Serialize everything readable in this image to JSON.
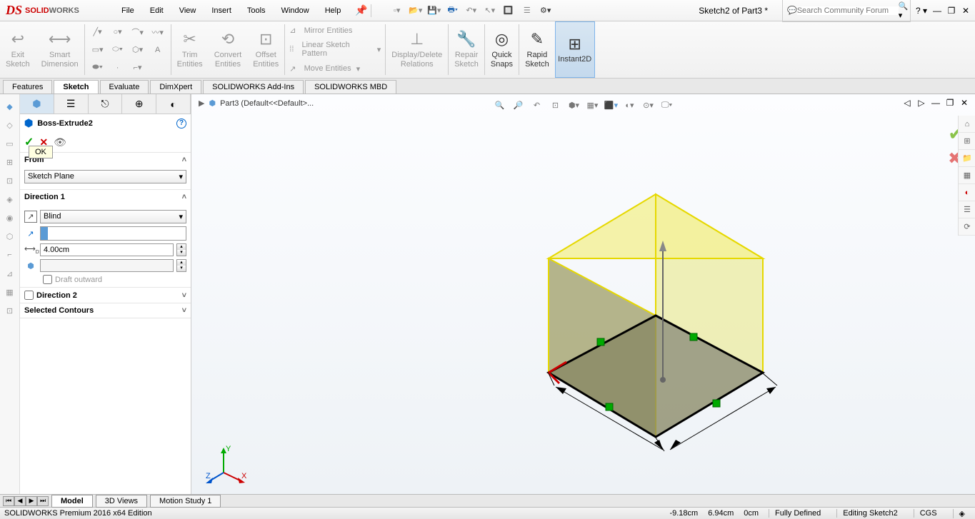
{
  "app": {
    "logo1": "SOLID",
    "logo2": "WORKS"
  },
  "menus": [
    "File",
    "Edit",
    "View",
    "Insert",
    "Tools",
    "Window",
    "Help"
  ],
  "doc_title": "Sketch2 of Part3 *",
  "search_placeholder": "Search Community Forum",
  "ribbon": {
    "exit_sketch": "Exit\nSketch",
    "smart_dim": "Smart\nDimension",
    "trim": "Trim\nEntities",
    "convert": "Convert\nEntities",
    "offset": "Offset\nEntities",
    "mirror": "Mirror Entities",
    "linear": "Linear Sketch Pattern",
    "move": "Move Entities",
    "display": "Display/Delete\nRelations",
    "repair": "Repair\nSketch",
    "quick": "Quick\nSnaps",
    "rapid": "Rapid\nSketch",
    "instant": "Instant2D"
  },
  "tabs": [
    "Features",
    "Sketch",
    "Evaluate",
    "DimXpert",
    "SOLIDWORKS Add-Ins",
    "SOLIDWORKS MBD"
  ],
  "active_tab": "Sketch",
  "breadcrumb": "Part3  (Default<<Default>...",
  "prop": {
    "title": "Boss-Extrude2",
    "ok_tooltip": "OK",
    "from_label": "From",
    "from_value": "Sketch Plane",
    "dir1_label": "Direction 1",
    "dir1_type": "Blind",
    "depth_label": "D1",
    "depth_value": "4.00cm",
    "draft_label": "Draft outward",
    "dir2_label": "Direction 2",
    "contours_label": "Selected Contours"
  },
  "bottom_tabs": [
    "Model",
    "3D Views",
    "Motion Study 1"
  ],
  "status": {
    "edition": "SOLIDWORKS Premium 2016 x64 Edition",
    "x": "-9.18cm",
    "y": "6.94cm",
    "z": "0cm",
    "defined": "Fully Defined",
    "editing": "Editing Sketch2",
    "units": "CGS"
  },
  "triad": {
    "x": "X",
    "y": "Y",
    "z": "Z"
  }
}
